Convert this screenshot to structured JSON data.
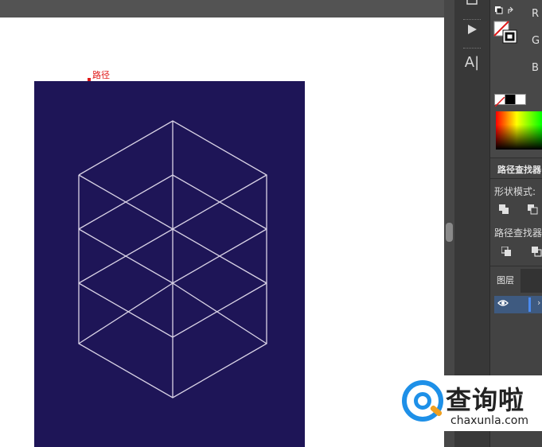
{
  "canvas": {
    "path_label": "路径",
    "artboard_color": "#1e1557",
    "line_color": "#d9d3e6"
  },
  "tools": {
    "play_icon": "play-icon",
    "type_tool_label": "A|"
  },
  "color_panel": {
    "r_label": "R",
    "g_label": "G",
    "b_label": "B"
  },
  "pathfinder_panel": {
    "title": "路径查找器",
    "shape_modes_label": "形状模式:",
    "pathfinders_label": "路径查找器"
  },
  "layers_panel": {
    "tab_label": "图层",
    "chevron": "›"
  },
  "watermark": {
    "brand_cn": "查询啦",
    "brand_en": "chaxunla.com"
  }
}
